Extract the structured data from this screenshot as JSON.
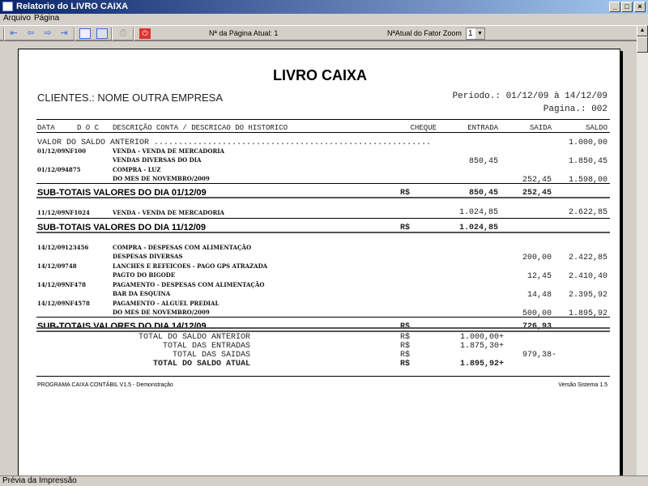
{
  "window": {
    "title": "Relatorio do LIVRO CAIXA"
  },
  "menu": [
    "Arquivo",
    "Página"
  ],
  "toolbar": {
    "page_label": "Nª da Página Atual: 1",
    "zoom_label": "NªAtual do Fator Zoom",
    "zoom_value": "1"
  },
  "report": {
    "title": "LIVRO CAIXA",
    "client": "CLIENTES.: NOME OUTRA EMPRESA",
    "period": "Periodo.: 01/12/09 à 14/12/09",
    "page": "Pagina.: 002",
    "headers": {
      "data": "DATA",
      "doc": "D O C",
      "desc": "DESCRIÇÃO CONTA / DESCRICAO DO HISTORICO",
      "cheque": "CHEQUE",
      "entrada": "ENTRADA",
      "saida": "SAIDA",
      "saldo": "SALDO"
    },
    "previous_balance": {
      "label": "VALOR DO SALDO ANTERIOR .........................................................",
      "value": "1.000,00"
    },
    "groups": [
      {
        "entries": [
          {
            "date": "01/12/09",
            "doc": "NF100",
            "desc": "VENDA - VENDA DE MERCADORIA",
            "hist": "VENDAS DIVERSAS DO DIA",
            "entrada": "850,45",
            "saida": "",
            "saldo": "1.850,45"
          },
          {
            "date": "01/12/09",
            "doc": "4875",
            "desc": "COMPRA - LUZ",
            "hist": "DO MES DE NOVEMBRO/2009",
            "entrada": "",
            "saida": "252,45",
            "saldo": "1.598,00"
          }
        ],
        "subtotal": {
          "label": "SUB-TOTAIS VALORES DO DIA 01/12/09",
          "currency": "R$",
          "entrada": "850,45",
          "saida": "252,45"
        }
      },
      {
        "entries": [
          {
            "date": "11/12/09",
            "doc": "NF1024",
            "desc": "VENDA - VENDA DE MERCADORIA",
            "hist": "",
            "entrada": "1.024,85",
            "saida": "",
            "saldo": "2.622,85"
          }
        ],
        "subtotal": {
          "label": "SUB-TOTAIS VALORES DO DIA 11/12/09",
          "currency": "R$",
          "entrada": "1.024,85",
          "saida": ""
        }
      },
      {
        "entries": [
          {
            "date": "14/12/09",
            "doc": "123456",
            "desc": "COMPRA - DESPESAS COM ALIMENTAÇÃO",
            "hist": "DESPESAS DIVERSAS",
            "entrada": "",
            "saida": "200,00",
            "saldo": "2.422,85"
          },
          {
            "date": "14/12/09",
            "doc": "748",
            "desc": "LANCHES E REFEICOES - PAGO GPS ATRAZADA",
            "hist": "PAGTO DO BIGODE",
            "entrada": "",
            "saida": "12,45",
            "saldo": "2.410,40"
          },
          {
            "date": "14/12/09",
            "doc": "NF478",
            "desc": "PAGAMENTO - DESPESAS COM ALIMENTAÇÃO",
            "hist": "BAR DA ESQUINA",
            "entrada": "",
            "saida": "14,48",
            "saldo": "2.395,92"
          },
          {
            "date": "14/12/09",
            "doc": "NF4578",
            "desc": "PAGAMENTO - ALGUEL PREDIAL",
            "hist": "DO MES DE NOVEMBRO/2009",
            "entrada": "",
            "saida": "500,00",
            "saldo": "1.895,92"
          }
        ],
        "subtotal": {
          "label": "SUB-TOTAIS VALORES DO DIA 14/12/09",
          "currency": "R$",
          "entrada": "",
          "saida": "726,93"
        }
      }
    ],
    "totals": [
      {
        "label": "TOTAL DO SALDO ANTERIOR",
        "currency": "R$",
        "entrada": "1.000,00+",
        "saida": "",
        "bold": false
      },
      {
        "label": "TOTAL DAS ENTRADAS",
        "currency": "R$",
        "entrada": "1.875,30+",
        "saida": "",
        "bold": false
      },
      {
        "label": "TOTAL DAS SAIDAS",
        "currency": "R$",
        "entrada": "",
        "saida": "979,38-",
        "bold": false
      },
      {
        "label": "TOTAL DO SALDO ATUAL",
        "currency": "R$",
        "entrada": "1.895,92+",
        "saida": "",
        "bold": true
      }
    ],
    "footer_left": "PROGRAMA CAIXA CONTÁBIL V1.5 - Demonstração",
    "footer_right": "Versão Sistema 1.5"
  },
  "status": "Prévia da Impressão"
}
